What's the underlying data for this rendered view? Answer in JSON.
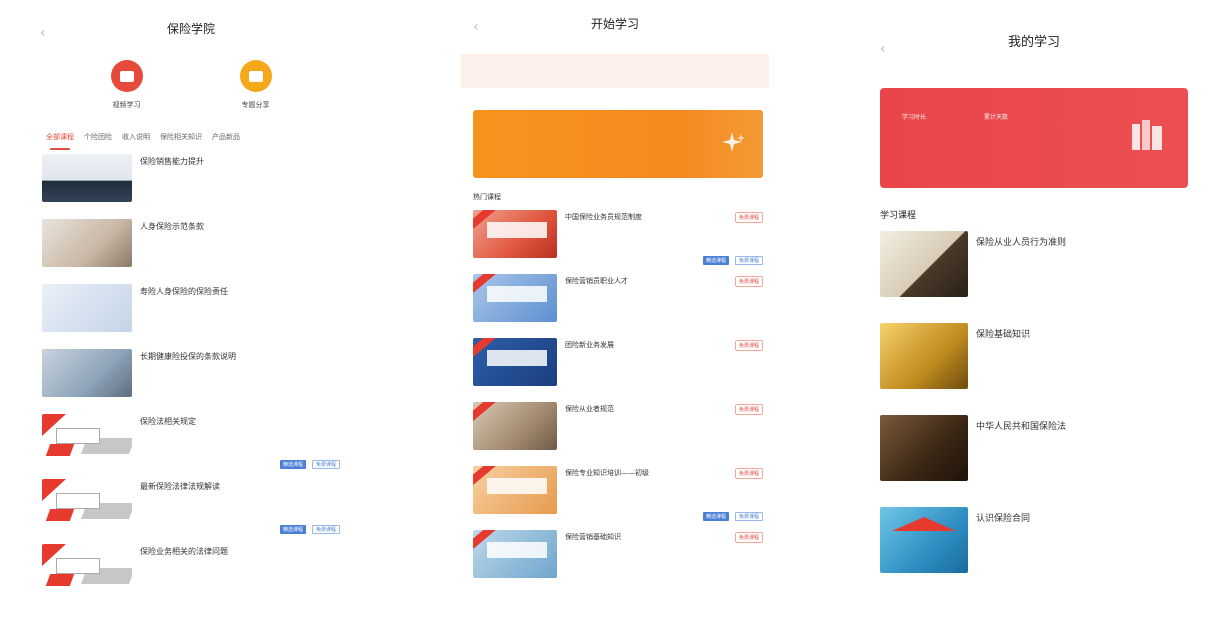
{
  "screen1": {
    "title": "保险学院",
    "entries": [
      {
        "label": "视频学习",
        "color": "#e64a3a"
      },
      {
        "label": "专题分享",
        "color": "#f7a81a"
      }
    ],
    "tabs": [
      "全部课程",
      "个险团险",
      "收入说明",
      "保险相关知识",
      "产品新品"
    ],
    "courses": [
      {
        "title": "保险销售能力提升"
      },
      {
        "title": "人身保险示范条款"
      },
      {
        "title": "寿险人身保险的保险责任"
      },
      {
        "title": "长期健康险投保的条款说明"
      },
      {
        "title": "保险法相关规定",
        "tag": "精选课程",
        "tag2": "免费课程"
      },
      {
        "title": "最新保险法律法规解读",
        "tag": "精选课程",
        "tag2": "免费课程"
      },
      {
        "title": "保险业务相关的法律问题"
      }
    ]
  },
  "screen2": {
    "title": "开始学习",
    "section": "热门课程",
    "courses": [
      {
        "title": "中国保险业务员规范制度",
        "badge": "免费课程",
        "tag": "精选课程",
        "tag2": "免费课程"
      },
      {
        "title": "保险营销员职业人才",
        "badge": "免费课程"
      },
      {
        "title": "团险新业务发展",
        "badge": "免费课程"
      },
      {
        "title": "保险从业者规范",
        "badge": "免费课程"
      },
      {
        "title": "保险专业知识培训——初级",
        "badge": "免费课程",
        "tag": "精选课程",
        "tag2": "免费课程"
      },
      {
        "title": "保险营销基础知识",
        "badge": "免费课程"
      }
    ]
  },
  "screen3": {
    "title": "我的学习",
    "stats": [
      {
        "label": "学习时长"
      },
      {
        "label": "累计天数"
      }
    ],
    "section": "学习课程",
    "courses": [
      {
        "title": "保险从业人员行为准则"
      },
      {
        "title": "保险基础知识"
      },
      {
        "title": "中华人民共和国保险法"
      },
      {
        "title": "认识保险合同"
      }
    ]
  }
}
